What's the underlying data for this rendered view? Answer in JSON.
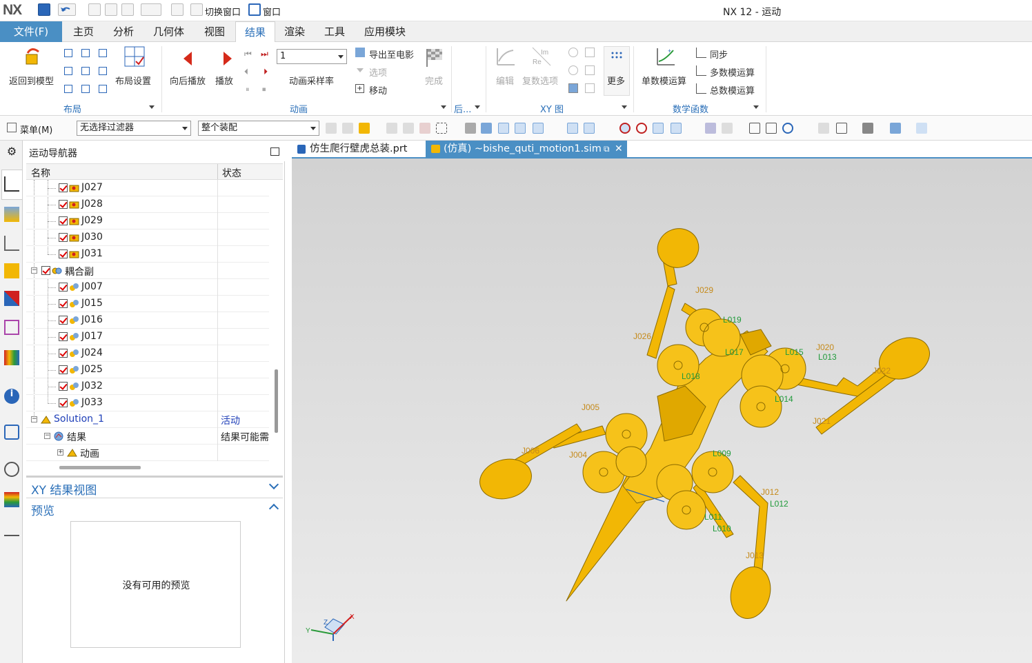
{
  "window": {
    "logo": "NX",
    "title": "NX 12 - 运动",
    "quick_access": {
      "switch_window": "切换窗口",
      "window": "窗口"
    }
  },
  "menubar": {
    "file": "文件(F)",
    "tabs": [
      "主页",
      "分析",
      "几何体",
      "视图",
      "结果",
      "渲染",
      "工具",
      "应用模块"
    ],
    "active_tab": "结果"
  },
  "ribbon": {
    "return_to_model": "返回到模型",
    "layout_settings": "布局设置",
    "group_layout": "布局",
    "play_backward": "向后播放",
    "play": "播放",
    "frame_value": "1",
    "animation_sample_rate": "动画采样率",
    "export_to_movie": "导出至电影",
    "options": "选项",
    "move": "移动",
    "finish": "完成",
    "group_animation": "动画",
    "group_post": "后...",
    "edit": "编辑",
    "complex_options": "复数选项",
    "more": "更多",
    "group_xy": "XY 图",
    "single_math": "单数模运算",
    "sync": "同步",
    "multi_math": "多数模运算",
    "total_math": "总数模运算",
    "group_math": "数学函数"
  },
  "toolbar": {
    "menu": "菜单(M)",
    "filter": "无选择过滤器",
    "scope": "整个装配"
  },
  "navigator": {
    "title": "运动导航器",
    "col_name": "名称",
    "col_status": "状态",
    "rows": [
      {
        "label": "J027",
        "status": ""
      },
      {
        "label": "J028",
        "status": ""
      },
      {
        "label": "J029",
        "status": ""
      },
      {
        "label": "J030",
        "status": ""
      },
      {
        "label": "J031",
        "status": ""
      },
      {
        "label": "耦合副",
        "status": ""
      },
      {
        "label": "J007",
        "status": ""
      },
      {
        "label": "J015",
        "status": ""
      },
      {
        "label": "J016",
        "status": ""
      },
      {
        "label": "J017",
        "status": ""
      },
      {
        "label": "J024",
        "status": ""
      },
      {
        "label": "J025",
        "status": ""
      },
      {
        "label": "J032",
        "status": ""
      },
      {
        "label": "J033",
        "status": ""
      },
      {
        "label": "Solution_1",
        "status": "活动"
      },
      {
        "label": "结果",
        "status": "结果可能需"
      },
      {
        "label": "动画",
        "status": ""
      }
    ]
  },
  "xy_results": {
    "title": "XY 结果视图"
  },
  "preview": {
    "title": "预览",
    "empty_text": "没有可用的预览"
  },
  "doc_tabs": [
    {
      "label": "仿生爬行壁虎总装.prt",
      "active": false
    },
    {
      "label": "(仿真) ~bishe_quti_motion1.sim",
      "active": true
    }
  ],
  "viewport": {
    "joint_labels_orange": [
      "J029",
      "J026",
      "J005",
      "J006",
      "J004",
      "J020",
      "J022",
      "J021",
      "J012",
      "J013"
    ],
    "joint_labels_green": [
      "L019",
      "L017",
      "L015",
      "L013",
      "L014",
      "L018",
      "L009",
      "L011",
      "L010",
      "L012"
    ],
    "triad": {
      "x": "X",
      "y": "Y",
      "z": "Z"
    },
    "colors": {
      "part": "#f2b705",
      "edge": "#8a6a00",
      "bg_top": "#d2d2d2",
      "bg_bottom": "#ececec"
    }
  }
}
